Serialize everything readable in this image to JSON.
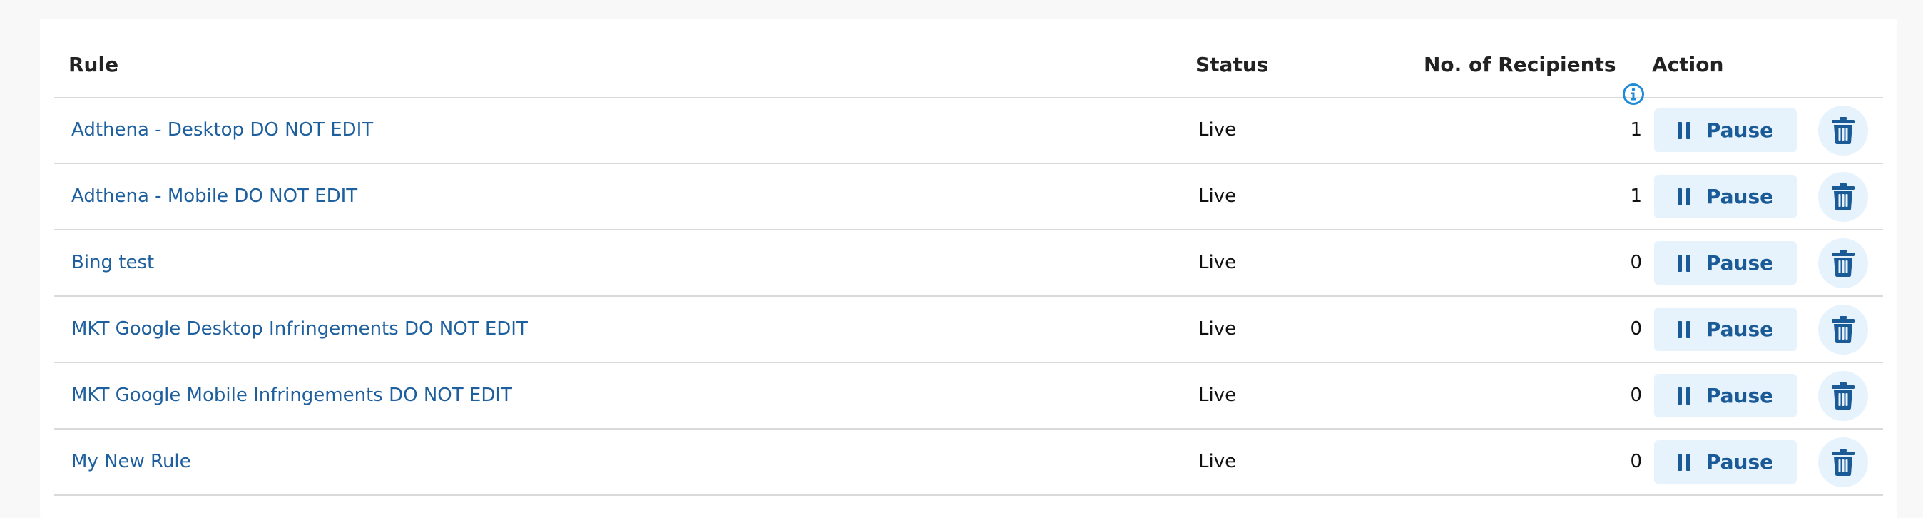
{
  "table": {
    "headers": {
      "rule": "Rule",
      "status": "Status",
      "recipients": "No. of Recipients",
      "action": "Action"
    },
    "rows": [
      {
        "name": "Adthena - Desktop DO NOT EDIT",
        "status": "Live",
        "recipients": "1",
        "action_label": "Pause"
      },
      {
        "name": "Adthena - Mobile DO NOT EDIT",
        "status": "Live",
        "recipients": "1",
        "action_label": "Pause"
      },
      {
        "name": "Bing test",
        "status": "Live",
        "recipients": "0",
        "action_label": "Pause"
      },
      {
        "name": "MKT Google Desktop Infringements DO NOT EDIT",
        "status": "Live",
        "recipients": "0",
        "action_label": "Pause"
      },
      {
        "name": "MKT Google Mobile Infringements DO NOT EDIT",
        "status": "Live",
        "recipients": "0",
        "action_label": "Pause"
      },
      {
        "name": "My New Rule",
        "status": "Live",
        "recipients": "0",
        "action_label": "Pause"
      }
    ]
  },
  "colors": {
    "link": "#1e5f9e",
    "button_bg": "#e6f2fc",
    "button_text": "#1a5a96",
    "info_icon": "#1d8bd8"
  },
  "icons": {
    "info": "info-icon",
    "pause": "pause-icon",
    "delete": "trash-icon"
  }
}
